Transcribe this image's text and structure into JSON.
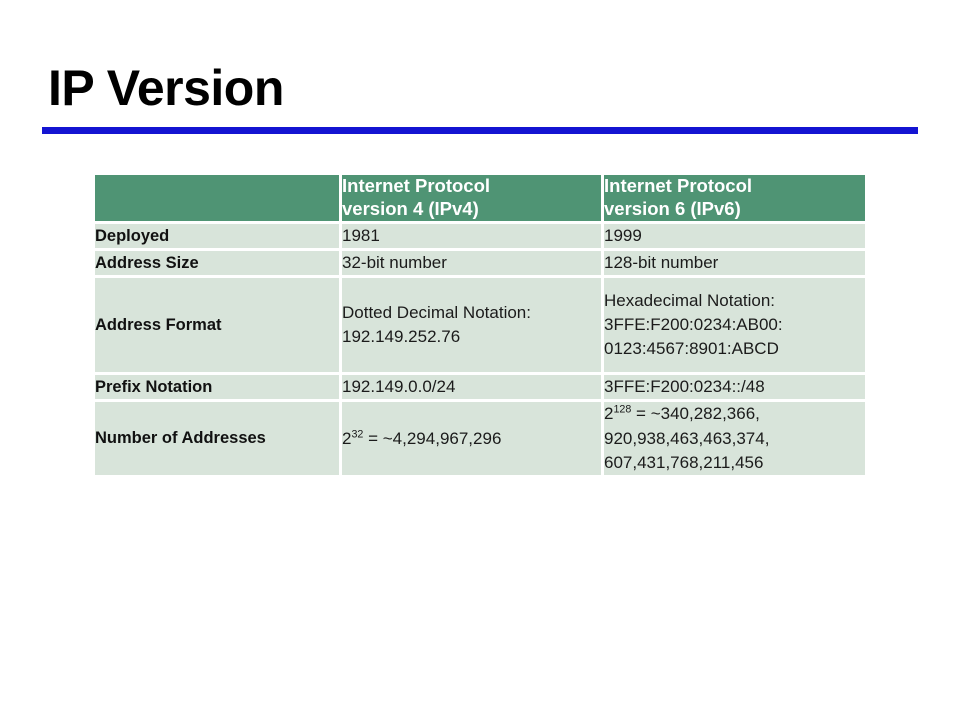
{
  "slide": {
    "title": "IP Version",
    "accent_rule_color": "#1414d2",
    "header_fill": "#4f9474",
    "cell_fill": "#d8e4da",
    "background": "#ffffff"
  },
  "table": {
    "columns": [
      {
        "id": "label",
        "header_line1": "",
        "header_line2": ""
      },
      {
        "id": "ipv4",
        "header_line1": "Internet Protocol",
        "header_line2": "version 4 (IPv4)"
      },
      {
        "id": "ipv6",
        "header_line1": "Internet Protocol",
        "header_line2": "version 6 (IPv6)"
      }
    ],
    "rows": [
      {
        "label": "Deployed",
        "ipv4": {
          "lines": [
            "1981"
          ]
        },
        "ipv6": {
          "lines": [
            "1999"
          ]
        }
      },
      {
        "label": "Address Size",
        "ipv4": {
          "lines": [
            "32-bit number"
          ]
        },
        "ipv6": {
          "lines": [
            "128-bit number"
          ]
        }
      },
      {
        "label": "Address Format",
        "ipv4": {
          "lines": [
            "Dotted Decimal Notation:",
            "192.149.252.76"
          ]
        },
        "ipv6": {
          "lines": [
            "Hexadecimal Notation:",
            "3FFE:F200:0234:AB00:",
            "0123:4567:8901:ABCD"
          ]
        }
      },
      {
        "label": "Prefix Notation",
        "ipv4": {
          "lines": [
            "192.149.0.0/24"
          ]
        },
        "ipv6": {
          "lines": [
            "3FFE:F200:0234::/48"
          ]
        }
      },
      {
        "label": "Number of Addresses",
        "ipv4": {
          "base": "2",
          "exponent": "32",
          "rest": " = ~4,294,967,296",
          "lines": []
        },
        "ipv6": {
          "base": "2",
          "exponent": "128",
          "rest": " = ~340,282,366,",
          "lines": [
            "920,938,463,463,374,",
            "607,431,768,211,456"
          ]
        }
      }
    ]
  }
}
